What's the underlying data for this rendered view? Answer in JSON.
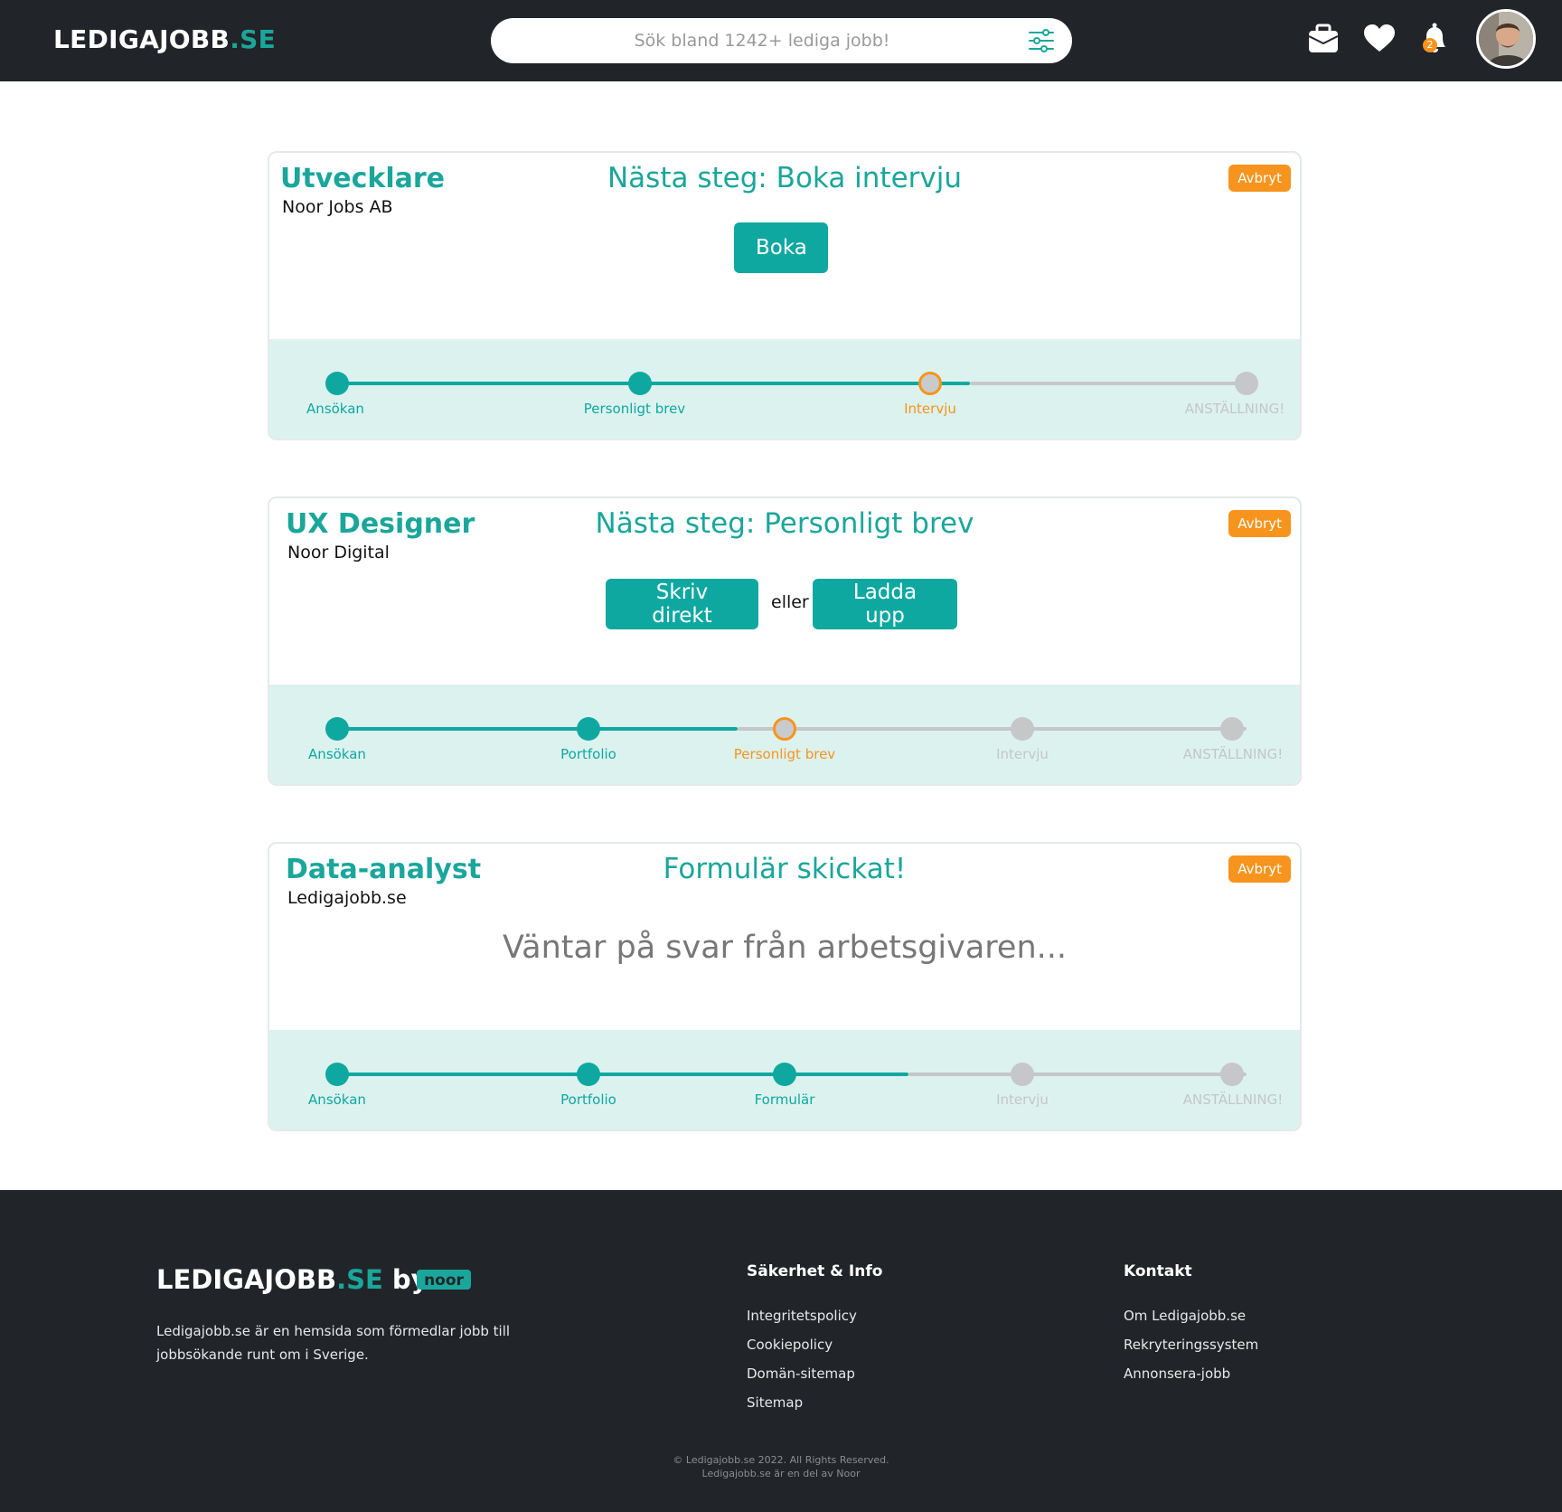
{
  "header": {
    "brand_main": "LEDIGAJOBB",
    "brand_tld": ".SE",
    "search_placeholder": "Sök bland 1242+ lediga jobb!",
    "notification_count": "2"
  },
  "applications": [
    {
      "title": "Utvecklare",
      "company": "Noor Jobs AB",
      "next_step": "Nästa steg: Boka intervju",
      "cancel_label": "Avbryt",
      "action_label": "Boka",
      "steps": [
        {
          "label": "Ansökan",
          "state": "done"
        },
        {
          "label": "Personligt brev",
          "state": "done"
        },
        {
          "label": "Intervju",
          "state": "current"
        },
        {
          "label": "ANSTÄLLNING!",
          "state": "future"
        }
      ]
    },
    {
      "title": "UX Designer",
      "company": "Noor Digital",
      "next_step": "Nästa steg: Personligt brev",
      "cancel_label": "Avbryt",
      "write_label": "Skriv direkt",
      "or_label": "eller",
      "upload_label": "Ladda upp",
      "steps": [
        {
          "label": "Ansökan",
          "state": "done"
        },
        {
          "label": "Portfolio",
          "state": "done"
        },
        {
          "label": "Personligt brev",
          "state": "current"
        },
        {
          "label": "Intervju",
          "state": "future"
        },
        {
          "label": "ANSTÄLLNING!",
          "state": "future"
        }
      ]
    },
    {
      "title": "Data-analyst",
      "company": "Ledigajobb.se",
      "next_step": "Formulär skickat!",
      "cancel_label": "Avbryt",
      "waiting_text": "Väntar på svar från arbetsgivaren...",
      "steps": [
        {
          "label": "Ansökan",
          "state": "done"
        },
        {
          "label": "Portfolio",
          "state": "done"
        },
        {
          "label": "Formulär",
          "state": "done"
        },
        {
          "label": "Intervju",
          "state": "future"
        },
        {
          "label": "ANSTÄLLNING!",
          "state": "future"
        }
      ]
    }
  ],
  "footer": {
    "brand_main": "LEDIGAJOBB",
    "brand_tld": ".SE",
    "brand_by": " by",
    "partner_logo": "noor",
    "description": "Ledigajobb.se är en hemsida som förmedlar jobb till jobbsökande runt om i Sverige.",
    "col1_heading": "Säkerhet & Info",
    "col1_links": [
      "Integritetspolicy",
      "Cookiepolicy",
      "Domän-sitemap",
      "Sitemap"
    ],
    "col2_heading": "Kontakt",
    "col2_links": [
      "Om Ledigajobb.se",
      "Rekryteringssystem",
      "Annonsera-jobb"
    ],
    "copyright": "© Ledigajobb.se 2022. All Rights Reserved.",
    "copyright_sub": "Ledigajobb.se är en del av Noor"
  },
  "colors": {
    "accent": "#1aa69b",
    "button": "#0fa8a0",
    "warning": "#f7941d",
    "dark": "#212529",
    "progress_bg": "#dcf2ef",
    "inactive": "#c6c7c9"
  },
  "icons": [
    "filter-icon",
    "briefcase-icon",
    "heart-icon",
    "bell-icon",
    "avatar"
  ]
}
